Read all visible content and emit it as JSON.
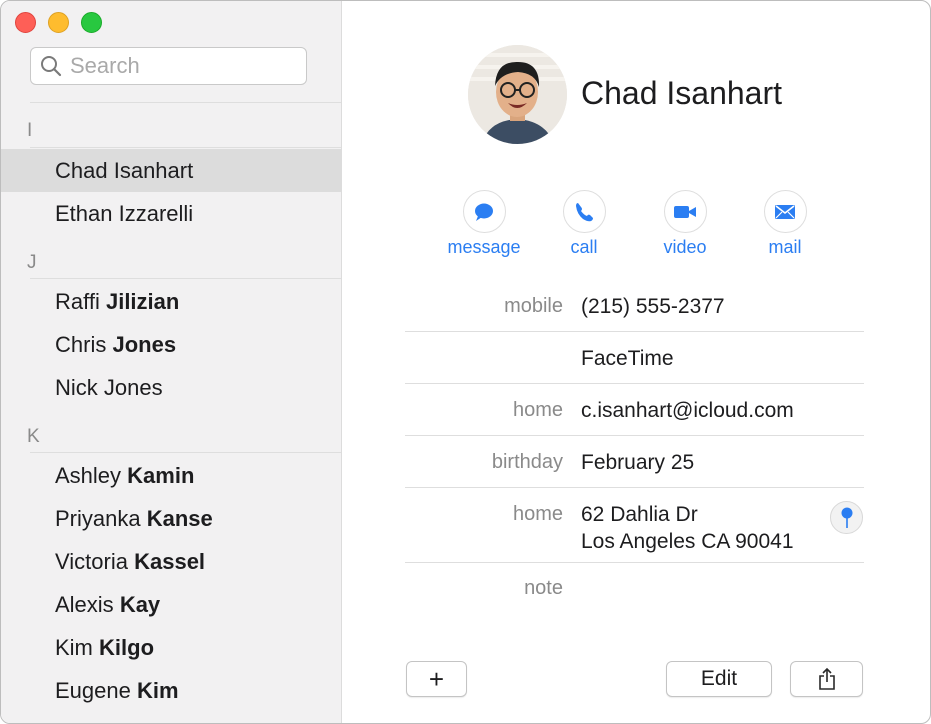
{
  "window": {
    "title_controls": [
      "close",
      "minimize",
      "zoom"
    ]
  },
  "search": {
    "placeholder": "Search",
    "value": ""
  },
  "sidebar": {
    "sections": [
      {
        "letter": "I",
        "contacts": [
          {
            "first": "Chad",
            "last": "Isanhart",
            "selected": true
          },
          {
            "first": "Ethan",
            "last": "Izzarelli",
            "selected": false
          }
        ]
      },
      {
        "letter": "J",
        "contacts": [
          {
            "first": "Raffi",
            "last": "Jilizian",
            "selected": false
          },
          {
            "first": "Chris",
            "last": "Jones",
            "selected": false
          },
          {
            "first": "Nick",
            "last": "Jones",
            "selected": false
          }
        ]
      },
      {
        "letter": "K",
        "contacts": [
          {
            "first": "Ashley",
            "last": "Kamin",
            "selected": false
          },
          {
            "first": "Priyanka",
            "last": "Kanse",
            "selected": false
          },
          {
            "first": "Victoria",
            "last": "Kassel",
            "selected": false
          },
          {
            "first": "Alexis",
            "last": "Kay",
            "selected": false
          },
          {
            "first": "Kim",
            "last": "Kilgo",
            "selected": false
          },
          {
            "first": "Eugene",
            "last": "Kim",
            "selected": false
          }
        ]
      }
    ]
  },
  "detail": {
    "name": "Chad Isanhart",
    "actions": [
      {
        "label": "message",
        "icon": "message-bubble-icon"
      },
      {
        "label": "call",
        "icon": "phone-icon"
      },
      {
        "label": "video",
        "icon": "video-camera-icon"
      },
      {
        "label": "mail",
        "icon": "envelope-icon"
      }
    ],
    "fields": {
      "mobile_label": "mobile",
      "mobile_value": "(215) 555-2377",
      "facetime_value": "FaceTime",
      "email_label": "home",
      "email_value": "c.isanhart@icloud.com",
      "birthday_label": "birthday",
      "birthday_value": "February 25",
      "address_label": "home",
      "address_line1": "62 Dahlia Dr",
      "address_line2": "Los Angeles CA 90041",
      "note_label": "note"
    },
    "buttons": {
      "add_symbol": "+",
      "edit": "Edit"
    }
  },
  "colors": {
    "accent": "#2b7ef2",
    "sidebar_bg": "#f2f1f2",
    "selected_row": "#dcdcdc",
    "close": "#fe5f57",
    "minimize": "#febc2e",
    "zoom": "#28c840"
  }
}
